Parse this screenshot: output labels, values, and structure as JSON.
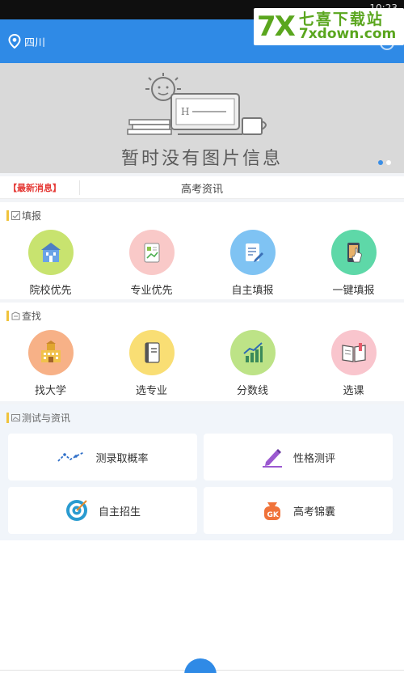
{
  "status_bar": {
    "time": "10:23"
  },
  "header": {
    "location": "四川"
  },
  "watermark": {
    "logo": "7X",
    "cn_text": "七喜下载站",
    "en_text": "7xdown.com"
  },
  "banner": {
    "empty_text": "暂时没有图片信息"
  },
  "news": {
    "tag": "【最新消息】",
    "title": "高考资讯"
  },
  "fill_section": {
    "title": "填报",
    "items": [
      {
        "label": "院校优先",
        "icon": "school-icon",
        "color": "#c8e36f"
      },
      {
        "label": "专业优先",
        "icon": "major-book-icon",
        "color": "#f9c9c8"
      },
      {
        "label": "自主填报",
        "icon": "edit-form-icon",
        "color": "#7fc3f3"
      },
      {
        "label": "一键填报",
        "icon": "tap-phone-icon",
        "color": "#5ed8a8"
      }
    ]
  },
  "search_section": {
    "title": "查找",
    "items": [
      {
        "label": "找大学",
        "icon": "university-building-icon",
        "color": "#f7b187"
      },
      {
        "label": "选专业",
        "icon": "notebook-icon",
        "color": "#f9de74"
      },
      {
        "label": "分数线",
        "icon": "bar-chart-icon",
        "color": "#bde387"
      },
      {
        "label": "选课",
        "icon": "open-book-icon",
        "color": "#f9c5cd"
      }
    ]
  },
  "tests_section": {
    "title": "测试与资讯",
    "cards": [
      {
        "label": "测录取概率",
        "icon": "trend-line-icon"
      },
      {
        "label": "性格测评",
        "icon": "pen-icon"
      },
      {
        "label": "自主招生",
        "icon": "target-icon"
      },
      {
        "label": "高考锦囊",
        "icon": "gk-bag-icon"
      }
    ]
  },
  "colors": {
    "primary": "#2f8ae6",
    "accent_bar": "#f0c33c",
    "news_red": "#e53935"
  }
}
